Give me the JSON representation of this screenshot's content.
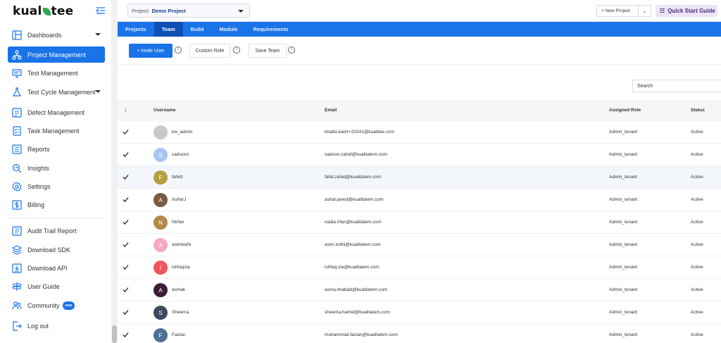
{
  "sidebar": {
    "logo": "kualitee",
    "items": [
      {
        "label": "Dashboards"
      },
      {
        "label": "Project Management"
      },
      {
        "label": "Test Management"
      },
      {
        "label": "Test Cycle Management"
      },
      {
        "label": "Defect Management"
      },
      {
        "label": "Task Management"
      },
      {
        "label": "Reports"
      },
      {
        "label": "Insights"
      },
      {
        "label": "Settings"
      },
      {
        "label": "Billing"
      },
      {
        "label": "Audit Trail Report"
      },
      {
        "label": "Download SDK"
      },
      {
        "label": "Download API"
      },
      {
        "label": "User Guide"
      },
      {
        "label": "Community",
        "badge": "new"
      },
      {
        "label": "Log out"
      }
    ]
  },
  "topbar": {
    "project_label": "Project:",
    "project_value": "Demo Project",
    "new_project": "+ New Project",
    "quick_start": "Quick Start Guide"
  },
  "tabs": [
    "Projects",
    "Team",
    "Build",
    "Module",
    "Requirements"
  ],
  "actions": {
    "invite": "+ Invite User",
    "custom_role": "Custom Role",
    "save_team": "Save Team",
    "info": "i"
  },
  "search": {
    "placeholder": "Search"
  },
  "table": {
    "headers": {
      "sort": "↓",
      "username": "Username",
      "email": "Email",
      "role": "Assigned Role",
      "status": "Status"
    },
    "rows": [
      {
        "initial": "",
        "color": "#c9c9c9",
        "username": "kw_admin",
        "email": "khalid.wazir+20241@kualitee.com",
        "role": "Admin_tenant",
        "status": "Active"
      },
      {
        "initial": "S",
        "color": "#a7c7f2",
        "username": "sadoonz",
        "email": "sadoon.zahid@kualitatem.com",
        "role": "Admin_tenant",
        "status": "Active"
      },
      {
        "initial": "F",
        "color": "#b3a043",
        "username": "fahdz",
        "email": "fahd.zahid@kualitatem.com",
        "role": "Admin_tenant",
        "status": "Active"
      },
      {
        "initial": "A",
        "color": "#7a5a45",
        "username": "AsharJ",
        "email": "ashar.javed@kualitatem.com",
        "role": "Admin_tenant",
        "status": "Active"
      },
      {
        "initial": "N",
        "color": "#b3894a",
        "username": "Nirfan",
        "email": "nadia.irfan@kualitatem.com",
        "role": "Admin_tenant",
        "status": "Active"
      },
      {
        "initial": "A",
        "color": "#f5a9c0",
        "username": "asimlodhi",
        "email": "asim.lodhi@kualitatem.com",
        "role": "Admin_tenant",
        "status": "Active"
      },
      {
        "initial": "I",
        "color": "#f0555a",
        "username": "ishfaqzia",
        "email": "ishfaq.zia@kualitatem.com",
        "role": "Admin_tenant",
        "status": "Active"
      },
      {
        "initial": "A",
        "color": "#3a1f38",
        "username": "asmak",
        "email": "asma.khabab@kualitatem.com",
        "role": "Admin_tenant",
        "status": "Active"
      },
      {
        "initial": "S",
        "color": "#3b4a5e",
        "username": "Sheema",
        "email": "sheema.hamid@kualitatem.com",
        "role": "Admin_tenant",
        "status": "Active"
      },
      {
        "initial": "F",
        "color": "#4f6f94",
        "username": "Faizan",
        "email": "muhammad.faizan@kualitatem.com",
        "role": "Admin_tenant",
        "status": "Active"
      }
    ]
  },
  "colors": {
    "primary": "#1a73e8",
    "tab_active": "#0f4fb3",
    "quick_start_bg": "#ece4f7"
  }
}
